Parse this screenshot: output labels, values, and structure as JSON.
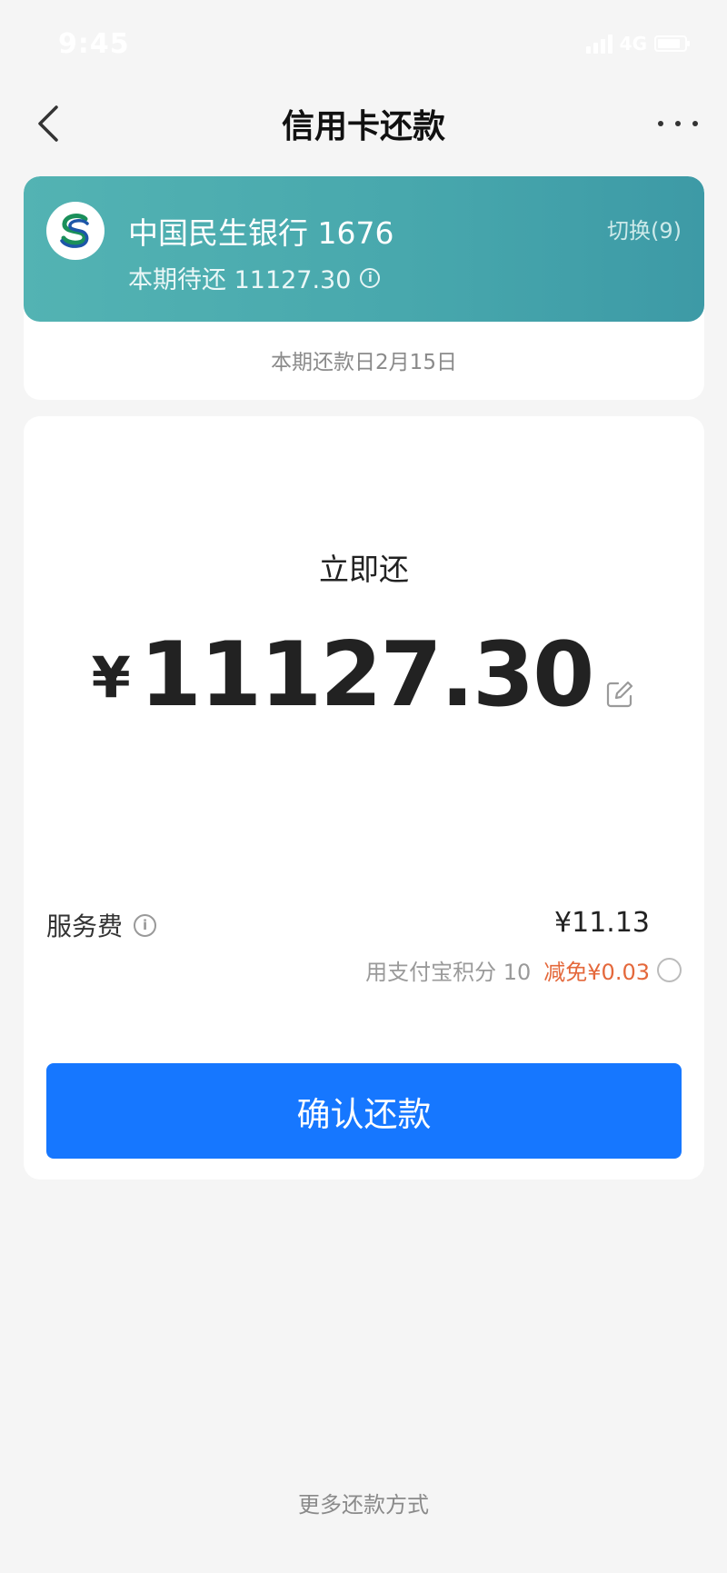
{
  "status_bar": {
    "time": "9:45",
    "network": "4G"
  },
  "nav": {
    "title": "信用卡还款"
  },
  "card": {
    "bank_name": "中国民生银行 1676",
    "due_text": "本期待还 11127.30",
    "info_icon": "i",
    "switch_label": "切换(9)",
    "due_date": "本期还款日2月15日",
    "header_color": "#4aabaf"
  },
  "repay": {
    "label": "立即还",
    "currency": "¥",
    "amount": "11127.30"
  },
  "fee": {
    "label": "服务费",
    "info_icon": "i",
    "value": "¥11.13",
    "points_text": "用支付宝积分 10",
    "discount_text": "减免¥0.03",
    "discount_color": "#e4683b"
  },
  "actions": {
    "confirm_label": "确认还款",
    "confirm_color": "#1677ff",
    "more_methods_label": "更多还款方式"
  }
}
